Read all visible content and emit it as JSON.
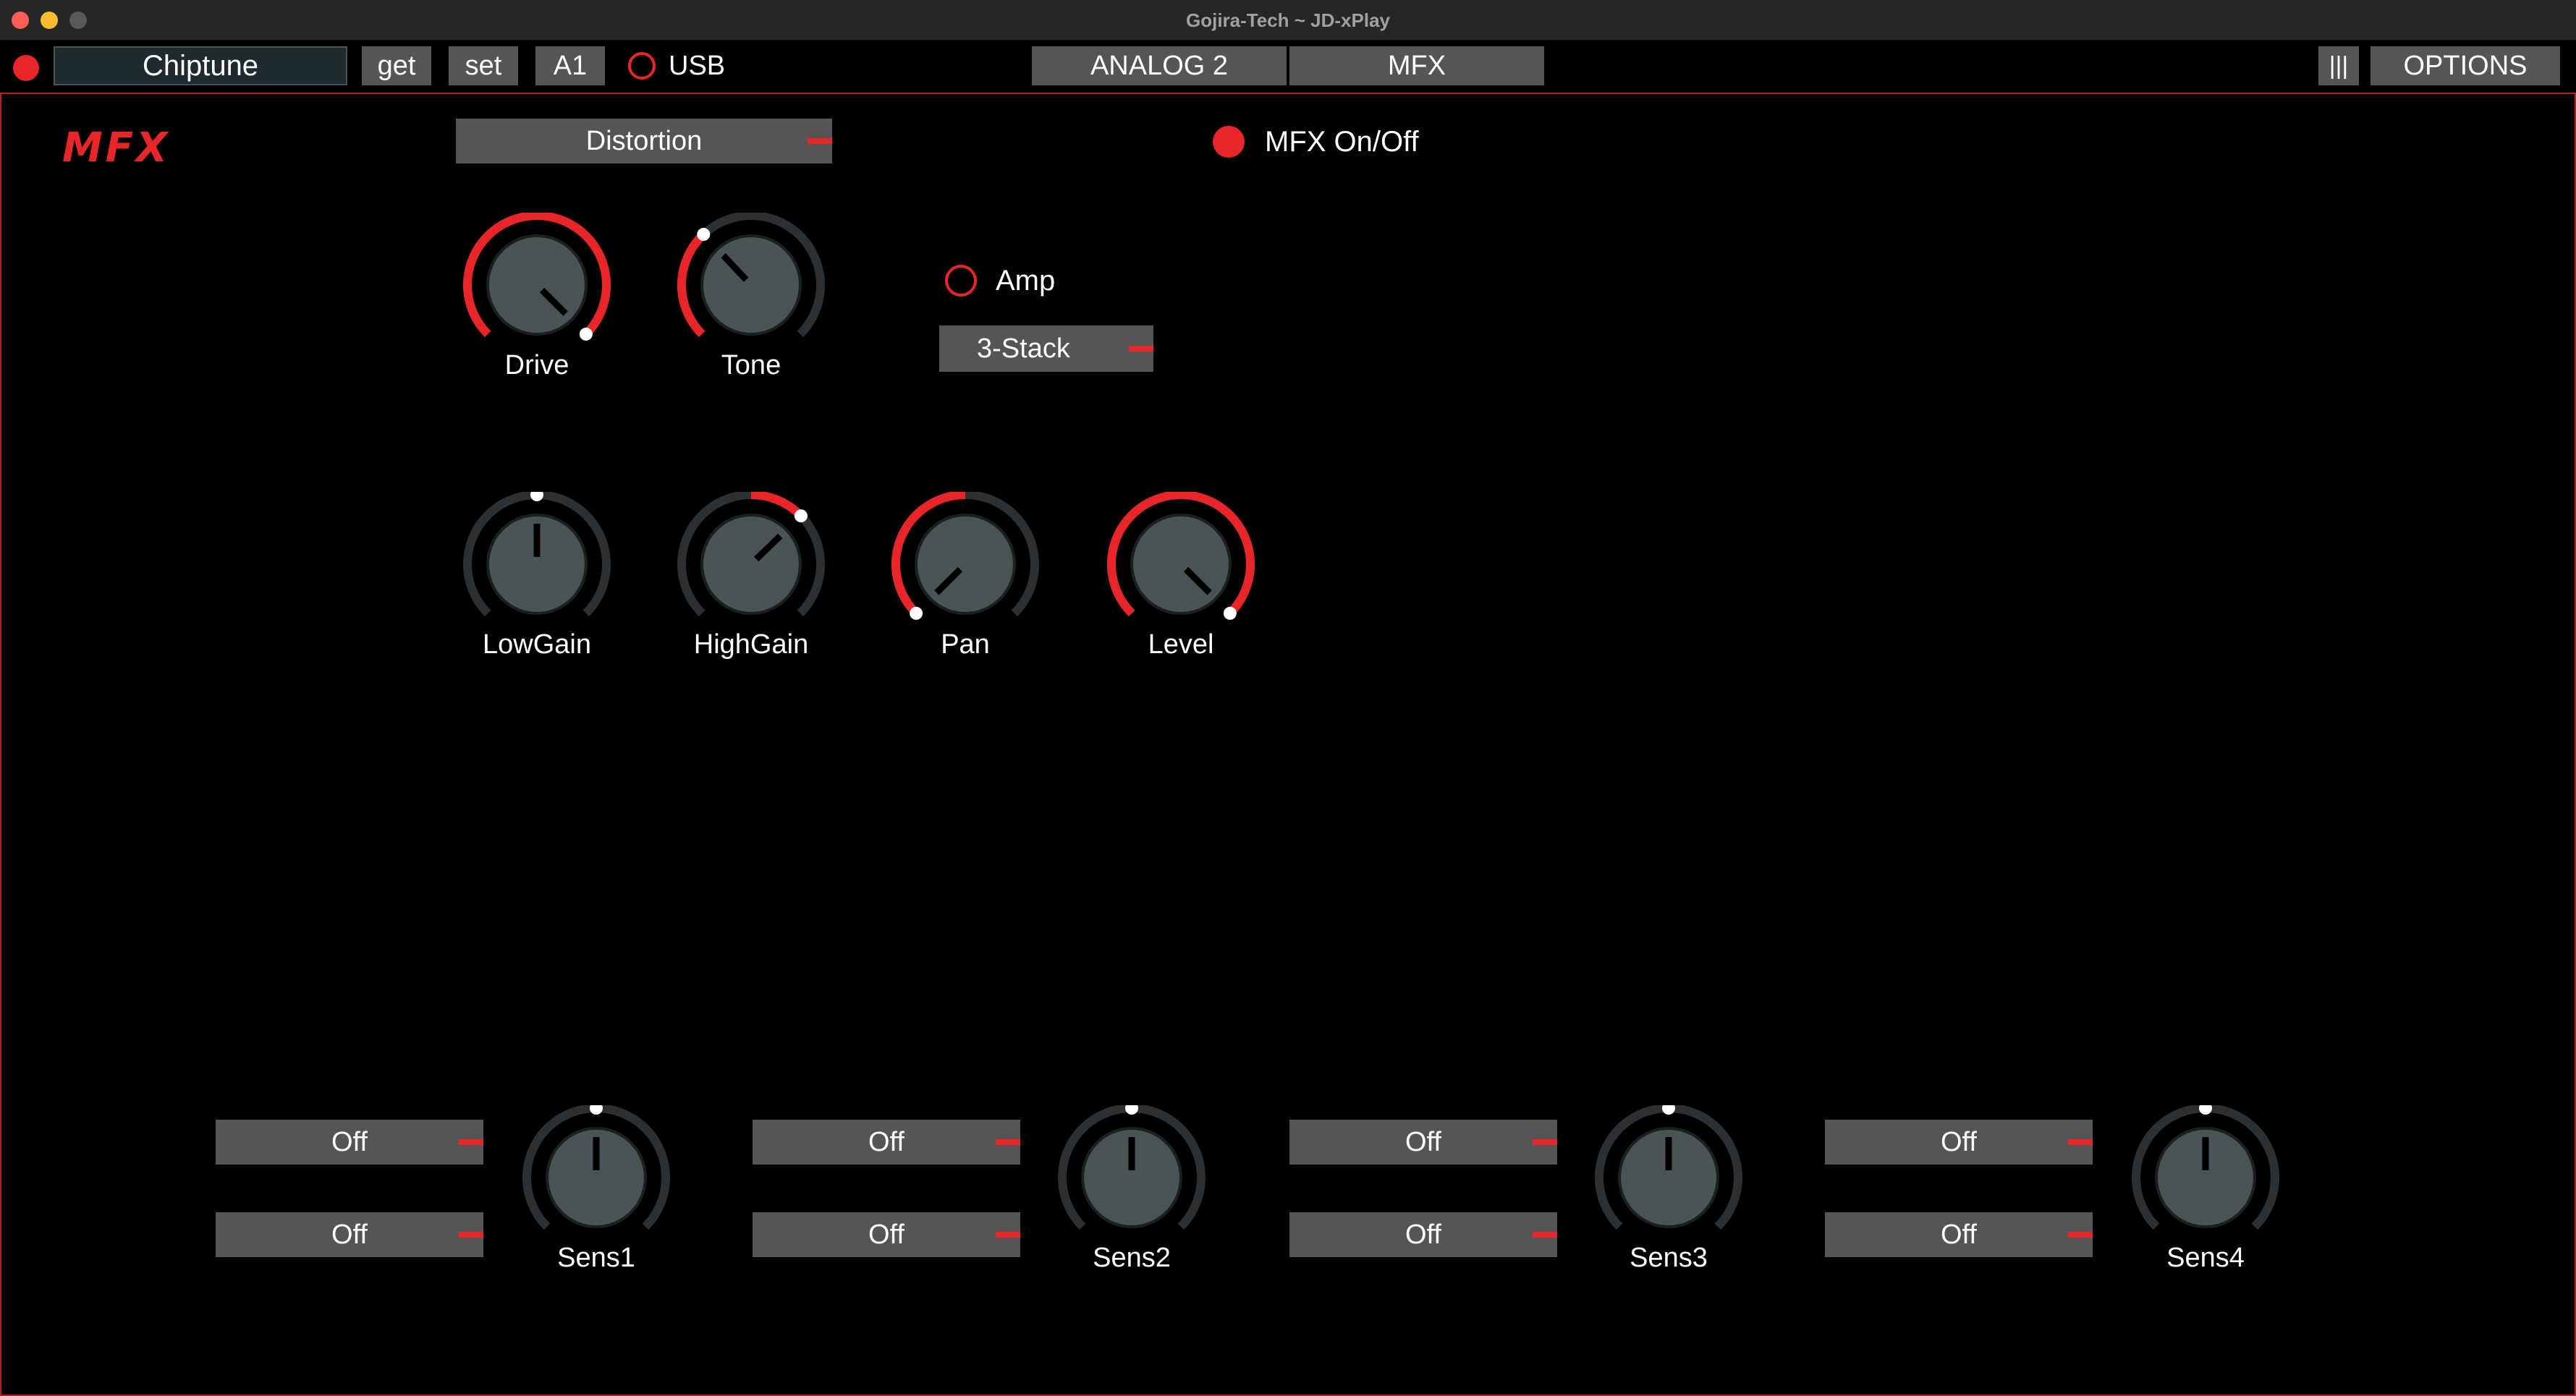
{
  "window": {
    "title": "Gojira-Tech  ~ JD-xPlay"
  },
  "toolbar": {
    "patch_name": "Chiptune",
    "get_label": "get",
    "set_label": "set",
    "bank_label": "A1",
    "usb_label": "USB",
    "tabs": [
      {
        "label": "ANALOG 2"
      },
      {
        "label": "MFX"
      }
    ],
    "menu_icon": "|||",
    "options_label": "OPTIONS"
  },
  "colors": {
    "accent": "#e8262a",
    "control_bg": "#555555",
    "knob_body": "#4a5355",
    "track": "#2a3033"
  },
  "mfx": {
    "logo": "MFX",
    "type_select": "Distortion",
    "onoff_label": "MFX On/Off",
    "onoff": true,
    "amp_label": "Amp",
    "amp_enabled": false,
    "amp_type": "3-Stack",
    "knobs": [
      {
        "label": "Drive",
        "value": 1.0,
        "mode": "uni"
      },
      {
        "label": "Tone",
        "value": 0.34,
        "mode": "uni"
      },
      {
        "label": "LowGain",
        "value": 0.5,
        "mode": "bi"
      },
      {
        "label": "HighGain",
        "value": 0.67,
        "mode": "bi"
      },
      {
        "label": "Pan",
        "value": 0.0,
        "mode": "bi"
      },
      {
        "label": "Level",
        "value": 1.0,
        "mode": "uni"
      }
    ],
    "sends": [
      {
        "source_a": "Off",
        "source_b": "Off",
        "label": "Sens1",
        "value": 0.5
      },
      {
        "source_a": "Off",
        "source_b": "Off",
        "label": "Sens2",
        "value": 0.5
      },
      {
        "source_a": "Off",
        "source_b": "Off",
        "label": "Sens3",
        "value": 0.5
      },
      {
        "source_a": "Off",
        "source_b": "Off",
        "label": "Sens4",
        "value": 0.5
      }
    ]
  }
}
